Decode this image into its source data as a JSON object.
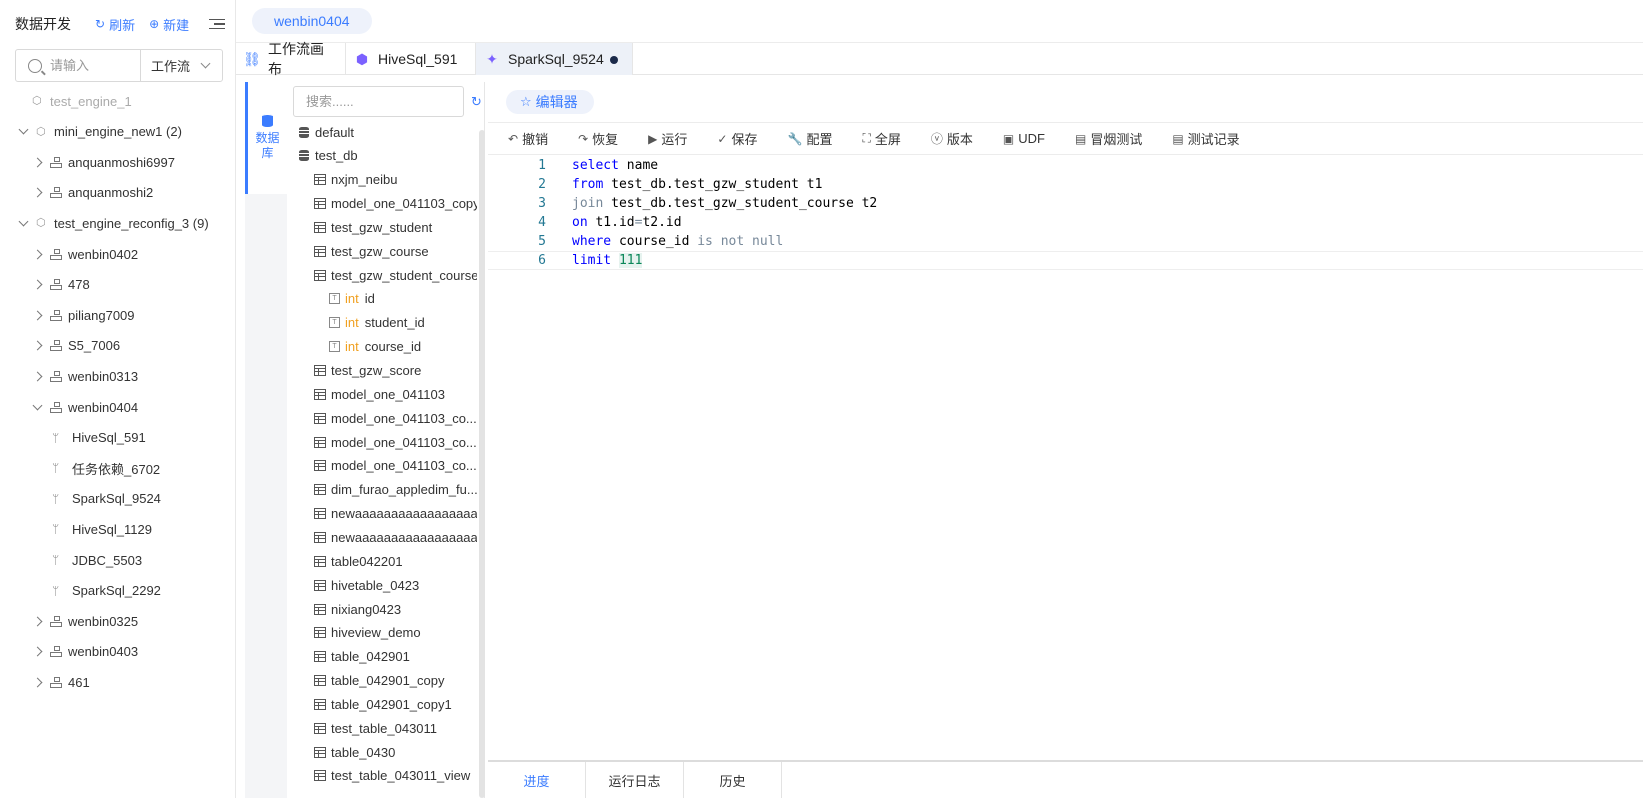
{
  "sidebar": {
    "title": "数据开发",
    "refresh_label": "刷新",
    "new_label": "新建",
    "search": {
      "placeholder": "请输入",
      "value": ""
    },
    "filter_select": "工作流",
    "tree": [
      {
        "label": "test_engine_1",
        "level": 0,
        "kind": "engine",
        "disabled": true
      },
      {
        "label": "mini_engine_new1 (2)",
        "level": 0,
        "kind": "engine",
        "expanded": true
      },
      {
        "label": "anquanmoshi6997",
        "level": 1,
        "kind": "workflow",
        "expanded": false
      },
      {
        "label": "anquanmoshi2",
        "level": 1,
        "kind": "workflow",
        "expanded": false
      },
      {
        "label": "test_engine_reconfig_3 (9)",
        "level": 0,
        "kind": "engine",
        "expanded": true
      },
      {
        "label": "wenbin0402",
        "level": 1,
        "kind": "workflow",
        "expanded": false
      },
      {
        "label": "478",
        "level": 1,
        "kind": "workflow",
        "expanded": false
      },
      {
        "label": "piliang7009",
        "level": 1,
        "kind": "workflow",
        "expanded": false
      },
      {
        "label": "S5_7006",
        "level": 1,
        "kind": "workflow",
        "expanded": false
      },
      {
        "label": "wenbin0313",
        "level": 1,
        "kind": "workflow",
        "expanded": false
      },
      {
        "label": "wenbin0404",
        "level": 1,
        "kind": "workflow",
        "expanded": true
      },
      {
        "label": "HiveSql_591",
        "level": 2,
        "kind": "task"
      },
      {
        "label": "任务依赖_6702",
        "level": 2,
        "kind": "task"
      },
      {
        "label": "SparkSql_9524",
        "level": 2,
        "kind": "task"
      },
      {
        "label": "HiveSql_1129",
        "level": 2,
        "kind": "task"
      },
      {
        "label": "JDBC_5503",
        "level": 2,
        "kind": "task"
      },
      {
        "label": "SparkSql_2292",
        "level": 2,
        "kind": "task"
      },
      {
        "label": "wenbin0325",
        "level": 1,
        "kind": "workflow",
        "expanded": false
      },
      {
        "label": "wenbin0403",
        "level": 1,
        "kind": "workflow",
        "expanded": false
      },
      {
        "label": "461",
        "level": 1,
        "kind": "workflow",
        "expanded": false
      }
    ]
  },
  "topbar": {
    "workflow_pill": "wenbin0404"
  },
  "tabs": [
    {
      "label": "工作流画布",
      "icon": "sitemap-icon",
      "active": false,
      "dirty": false
    },
    {
      "label": "HiveSql_591",
      "icon": "hive-icon",
      "active": false,
      "dirty": false
    },
    {
      "label": "SparkSql_9524",
      "icon": "spark-icon",
      "active": true,
      "dirty": true
    }
  ],
  "db": {
    "rail_label_line1": "数据",
    "rail_label_line2": "库",
    "search_placeholder": "搜索......",
    "nodes": [
      {
        "label": "default",
        "kind": "database",
        "level": 0
      },
      {
        "label": "test_db",
        "kind": "database",
        "level": 0
      },
      {
        "label": "nxjm_neibu",
        "kind": "table",
        "level": 1
      },
      {
        "label": "model_one_041103_copy",
        "kind": "table",
        "level": 1
      },
      {
        "label": "test_gzw_student",
        "kind": "table",
        "level": 1
      },
      {
        "label": "test_gzw_course",
        "kind": "table",
        "level": 1
      },
      {
        "label": "test_gzw_student_course",
        "kind": "table",
        "level": 1
      },
      {
        "label": "id",
        "type": "int",
        "kind": "column",
        "level": 2
      },
      {
        "label": "student_id",
        "type": "int",
        "kind": "column",
        "level": 2
      },
      {
        "label": "course_id",
        "type": "int",
        "kind": "column",
        "level": 2
      },
      {
        "label": "test_gzw_score",
        "kind": "table",
        "level": 1
      },
      {
        "label": "model_one_041103",
        "kind": "table",
        "level": 1
      },
      {
        "label": "model_one_041103_co...",
        "kind": "table",
        "level": 1
      },
      {
        "label": "model_one_041103_co...",
        "kind": "table",
        "level": 1
      },
      {
        "label": "model_one_041103_co...",
        "kind": "table",
        "level": 1
      },
      {
        "label": "dim_furao_appledim_fu...",
        "kind": "table",
        "level": 1
      },
      {
        "label": "newaaaaaaaaaaaaaaaaa...",
        "kind": "table",
        "level": 1
      },
      {
        "label": "newaaaaaaaaaaaaaaaaa...",
        "kind": "table",
        "level": 1
      },
      {
        "label": "table042201",
        "kind": "table",
        "level": 1
      },
      {
        "label": "hivetable_0423",
        "kind": "table",
        "level": 1
      },
      {
        "label": "nixiang0423",
        "kind": "table",
        "level": 1
      },
      {
        "label": "hiveview_demo",
        "kind": "table",
        "level": 1
      },
      {
        "label": "table_042901",
        "kind": "table",
        "level": 1
      },
      {
        "label": "table_042901_copy",
        "kind": "table",
        "level": 1
      },
      {
        "label": "table_042901_copy1",
        "kind": "table",
        "level": 1
      },
      {
        "label": "test_table_043011",
        "kind": "table",
        "level": 1
      },
      {
        "label": "table_0430",
        "kind": "table",
        "level": 1
      },
      {
        "label": "test_table_043011_view",
        "kind": "table",
        "level": 1
      }
    ]
  },
  "editor": {
    "mode_pill": "编辑器",
    "toolbar": [
      {
        "label": "撤销",
        "icon": "undo-icon",
        "glyph": "↶"
      },
      {
        "label": "恢复",
        "icon": "redo-icon",
        "glyph": "↷"
      },
      {
        "label": "运行",
        "icon": "play-icon",
        "glyph": "▶"
      },
      {
        "label": "保存",
        "icon": "check-icon",
        "glyph": "✓"
      },
      {
        "label": "配置",
        "icon": "wrench-icon",
        "glyph": "🔧"
      },
      {
        "label": "全屏",
        "icon": "fullscreen-icon",
        "glyph": "⛶"
      },
      {
        "label": "版本",
        "icon": "version-icon",
        "glyph": "ⓥ"
      },
      {
        "label": "UDF",
        "icon": "udf-icon",
        "glyph": "▣"
      },
      {
        "label": "冒烟测试",
        "icon": "smoke-test-icon",
        "glyph": "▤"
      },
      {
        "label": "测试记录",
        "icon": "test-record-icon",
        "glyph": "▤"
      }
    ],
    "code_lines": [
      {
        "num": "1",
        "tokens": [
          [
            "kw",
            "select"
          ],
          [
            "t",
            " name"
          ]
        ]
      },
      {
        "num": "2",
        "tokens": [
          [
            "kw",
            "from"
          ],
          [
            "t",
            " test_db.test_gzw_student t1"
          ]
        ]
      },
      {
        "num": "3",
        "tokens": [
          [
            "kw2",
            "join"
          ],
          [
            "t",
            " test_db.test_gzw_student_course t2"
          ]
        ]
      },
      {
        "num": "4",
        "tokens": [
          [
            "kw",
            "on"
          ],
          [
            "t",
            " t1.id"
          ],
          [
            "kw2",
            "="
          ],
          [
            "t",
            "t2.id"
          ]
        ]
      },
      {
        "num": "5",
        "tokens": [
          [
            "kw",
            "where"
          ],
          [
            "t",
            " course_id "
          ],
          [
            "kw2",
            "is not null"
          ]
        ]
      },
      {
        "num": "6",
        "tokens": [
          [
            "kw",
            "limit"
          ],
          [
            "t",
            " "
          ],
          [
            "num",
            "111"
          ]
        ]
      }
    ],
    "bottom_tabs": [
      {
        "label": "进度",
        "active": true
      },
      {
        "label": "运行日志",
        "active": false
      },
      {
        "label": "历史",
        "active": false
      }
    ]
  },
  "colors": {
    "accent": "#3b7cff",
    "keyword": "#0000ff",
    "muted_keyword": "#778899",
    "number": "#098658",
    "column_type": "#f0a020"
  }
}
